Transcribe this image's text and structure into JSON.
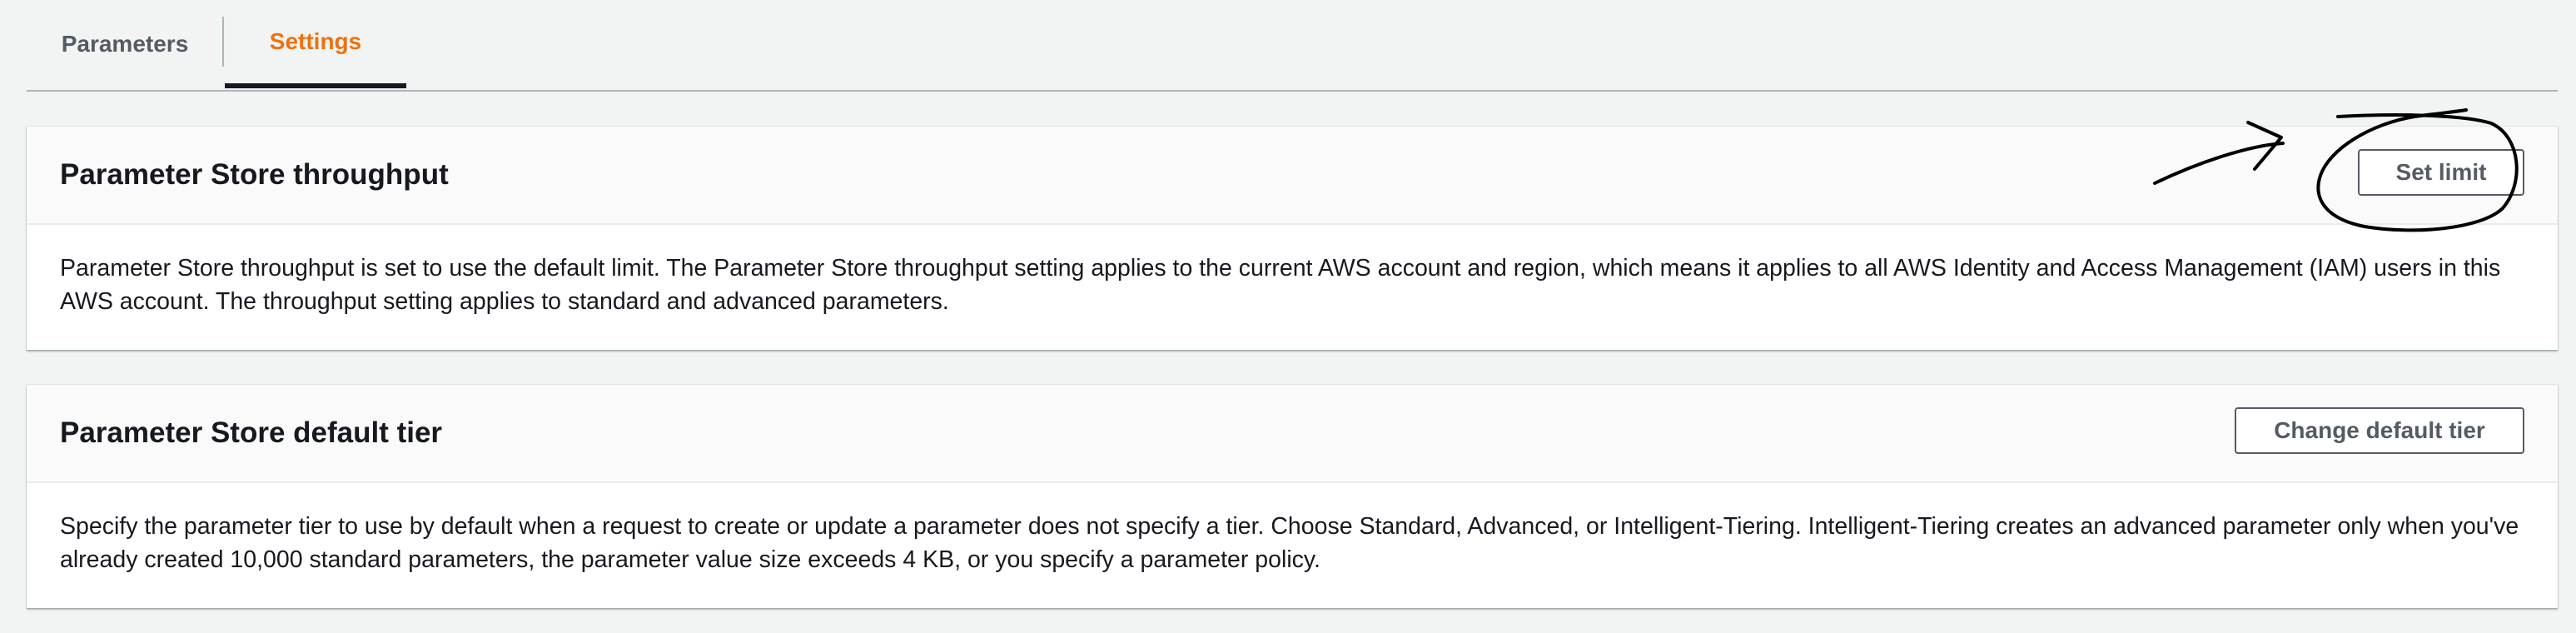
{
  "tabs": [
    {
      "label": "Parameters",
      "active": false
    },
    {
      "label": "Settings",
      "active": true
    }
  ],
  "throughput": {
    "title": "Parameter Store throughput",
    "button_label": "Set limit",
    "description": "Parameter Store throughput is set to use the default limit. The Parameter Store throughput setting applies to the current AWS account and region, which means it applies to all AWS Identity and Access Management (IAM) users in this AWS account. The throughput setting applies to standard and advanced parameters."
  },
  "default_tier": {
    "title": "Parameter Store default tier",
    "button_label": "Change default tier",
    "description": "Specify the parameter tier to use by default when a request to create or update a parameter does not specify a tier. Choose Standard, Advanced, or Intelligent-Tiering. Intelligent-Tiering creates an advanced parameter only when you've already created 10,000 standard parameters, the parameter value size exceeds 4 KB, or you specify a parameter policy."
  },
  "colors": {
    "active_tab": "#ec7211",
    "button_border": "#545b64",
    "annotation_ink": "#000000"
  },
  "annotation": {
    "description_icons": [
      "hand-drawn-arrow-icon",
      "hand-drawn-circle-icon"
    ]
  }
}
